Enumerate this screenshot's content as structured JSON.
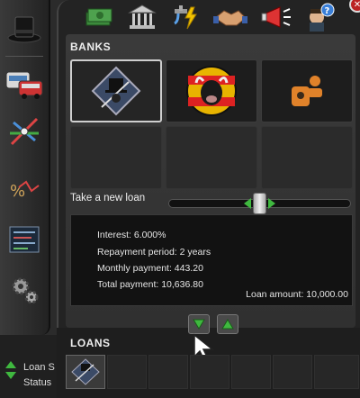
{
  "tabs": [
    {
      "icon": "money-icon"
    },
    {
      "icon": "bank-building-icon"
    },
    {
      "icon": "utilities-icon"
    },
    {
      "icon": "handshake-icon"
    },
    {
      "icon": "megaphone-icon"
    },
    {
      "icon": "advisor-help-icon"
    }
  ],
  "left_toolbar": [
    {
      "icon": "top-hat-icon"
    },
    {
      "icon": "vehicles-icon"
    },
    {
      "icon": "route-network-icon"
    },
    {
      "icon": "percent-chart-icon"
    },
    {
      "icon": "timetable-icon"
    },
    {
      "icon": "settings-gears-icon"
    }
  ],
  "banks": {
    "title": "BANKS",
    "slots": [
      {
        "name": "bank-tophat-logo",
        "active": true
      },
      {
        "name": "bank-bull-logo",
        "active": false
      },
      {
        "name": "bank-orange-logo",
        "active": false
      },
      {
        "name": "empty",
        "active": false
      },
      {
        "name": "empty",
        "active": false
      },
      {
        "name": "empty",
        "active": false
      }
    ]
  },
  "new_loan": {
    "label": "Take a new loan",
    "slider_fraction": 0.53
  },
  "loan_info": {
    "interest": "Interest: 6.000%",
    "repayment": "Repayment period: 2 years",
    "monthly": "Monthly payment: 443.20",
    "total": "Total payment: 10,636.80",
    "amount": "Loan amount: 10,000.00"
  },
  "loans": {
    "title": "LOANS"
  },
  "status": {
    "line1": "Loan S",
    "line2": "Status"
  },
  "colors": {
    "accent_green": "#3fb83f",
    "panel_bg": "#232323",
    "close_red": "#bb2222"
  }
}
